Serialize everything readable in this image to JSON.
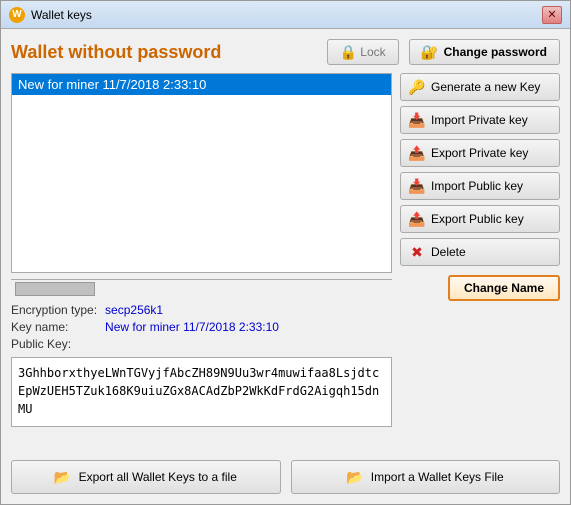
{
  "window": {
    "title": "Wallet keys",
    "icon": "W"
  },
  "header": {
    "wallet_title": "Wallet without password",
    "lock_label": "Lock",
    "change_password_label": "Change password"
  },
  "key_list": {
    "items": [
      {
        "label": "New for miner 11/7/2018 2:33:10"
      }
    ],
    "selected_index": 0
  },
  "key_info": {
    "encryption_label": "Encryption type:",
    "encryption_value": "secp256k1",
    "keyname_label": "Key name:",
    "keyname_value": "New for miner 11/7/2018 2:33:10",
    "publickey_label": "Public Key:",
    "publickey_value": "3GhhborxthyeLWnTGVyjfAbcZH89N9Uu3wr4muwifaa8LsjdtcEpWzUEH5TZuk168K9uiuZGx8ACAdZbP2WkKdFrdG2Aigqh15dnMU"
  },
  "buttons": {
    "generate_new_key": "Generate a new Key",
    "import_private_key": "Import Private key",
    "export_private_key": "Export Private key",
    "import_public_key": "Import Public key",
    "export_public_key": "Export Public key",
    "delete": "Delete",
    "change_name": "Change Name"
  },
  "bottom_buttons": {
    "export_wallet": "Export all Wallet Keys to a file",
    "import_wallet": "Import a Wallet Keys File"
  },
  "icons": {
    "key_generate": "🔑",
    "key_import": "📥",
    "key_export": "📤",
    "folder_export": "📂",
    "folder_import": "📂",
    "lock": "🔒",
    "password": "🔐",
    "delete": "✖"
  }
}
